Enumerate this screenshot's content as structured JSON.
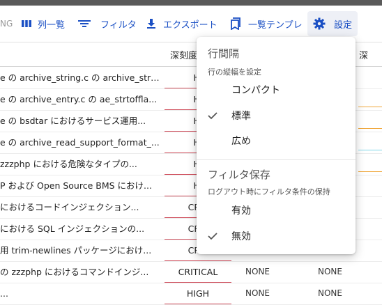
{
  "toolbar": {
    "cut_label": "NG",
    "columns_label": "列一覧",
    "filter_label": "フィルタ",
    "export_label": "エクスポート",
    "template_label": "一覧テンプレ",
    "settings_label": "設定"
  },
  "table": {
    "headers": [
      "深刻度",
      "",
      "深"
    ],
    "rows": [
      {
        "title": "e の archive_string.c の archive_stri...",
        "severity": "HI",
        "c3": "",
        "c4": ""
      },
      {
        "title": "e の archive_entry.c の ae_strtofflа...",
        "severity": "HI",
        "c3": "",
        "c4": ""
      },
      {
        "title": "e の bsdtar におけるサービス運用...",
        "severity": "HI",
        "c3": "",
        "c4": ""
      },
      {
        "title": "e の archive_read_support_format_...",
        "severity": "HI",
        "c3": "",
        "c4": ""
      },
      {
        "title": "zzzphp における危険なタイプの...",
        "severity": "HI",
        "c3": "",
        "c4": ""
      },
      {
        "title": "P および Open Source BMS におけ...",
        "severity": "HI",
        "c3": "",
        "c4": ""
      },
      {
        "title": "におけるコードインジェクション...",
        "severity": "CRIT",
        "c3": "",
        "c4": ""
      },
      {
        "title": "における SQL インジェクションの...",
        "severity": "CRIT",
        "c3": "",
        "c4": ""
      },
      {
        "title": "用 trim-newlines パッケージにおけ...",
        "severity": "CRIT",
        "c3": "",
        "c4": ""
      },
      {
        "title": "の zzzphp におけるコマンドインジ...",
        "severity": "CRITICAL",
        "c3": "NONE",
        "c4": "NONE"
      },
      {
        "title": "...",
        "severity": "HIGH",
        "c3": "NONE",
        "c4": "NONE"
      }
    ]
  },
  "menu": {
    "row_spacing": {
      "title": "行間隔",
      "subtitle": "行の縦幅を設定",
      "options": [
        {
          "label": "コンパクト",
          "checked": false
        },
        {
          "label": "標準",
          "checked": true
        },
        {
          "label": "広め",
          "checked": false
        }
      ]
    },
    "filter_save": {
      "title": "フィルタ保存",
      "subtitle": "ログアウト時にフィルタ条件の保持",
      "options": [
        {
          "label": "有効",
          "checked": false
        },
        {
          "label": "無効",
          "checked": true
        }
      ]
    }
  },
  "colors": {
    "accent_blue": "#1a4fc4",
    "severity_underline": "#cf4c5a",
    "orange_accent": "#f0a73a",
    "cyan_accent": "#7fd6e8"
  }
}
